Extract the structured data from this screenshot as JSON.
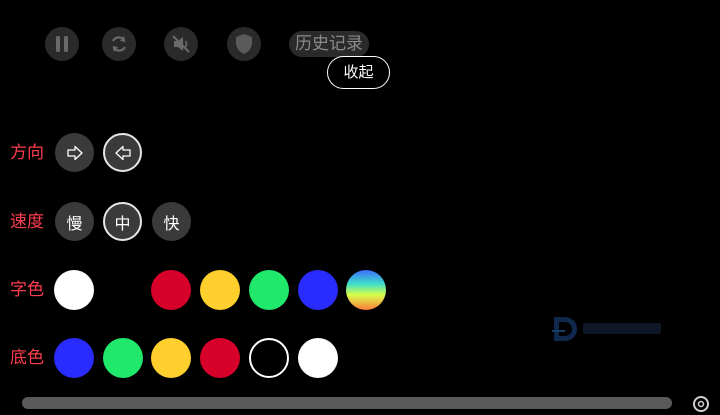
{
  "toolbar": {
    "pause_icon": "pause-icon",
    "refresh_icon": "refresh-icon",
    "mute_icon": "mute-icon",
    "shield_icon": "shield-icon",
    "history_label": "历史记录",
    "collapse_label": "收起"
  },
  "direction": {
    "label": "方向",
    "options": [
      {
        "icon": "arrow-right-icon",
        "selected": false
      },
      {
        "icon": "arrow-left-icon",
        "selected": true
      }
    ]
  },
  "speed": {
    "label": "速度",
    "options": [
      {
        "label": "慢",
        "selected": false
      },
      {
        "label": "中",
        "selected": true
      },
      {
        "label": "快",
        "selected": false
      }
    ]
  },
  "font_color": {
    "label": "字色",
    "swatches": [
      "#ffffff",
      "#000000",
      "#d6002b",
      "#ffcf2e",
      "#1fe86a",
      "#2a2bff",
      "rainbow-gradient"
    ]
  },
  "bg_color": {
    "label": "底色",
    "swatches": [
      "#2a2bff",
      "#1fe86a",
      "#ffcf2e",
      "#d6002b",
      "#000000",
      "#ffffff"
    ]
  }
}
